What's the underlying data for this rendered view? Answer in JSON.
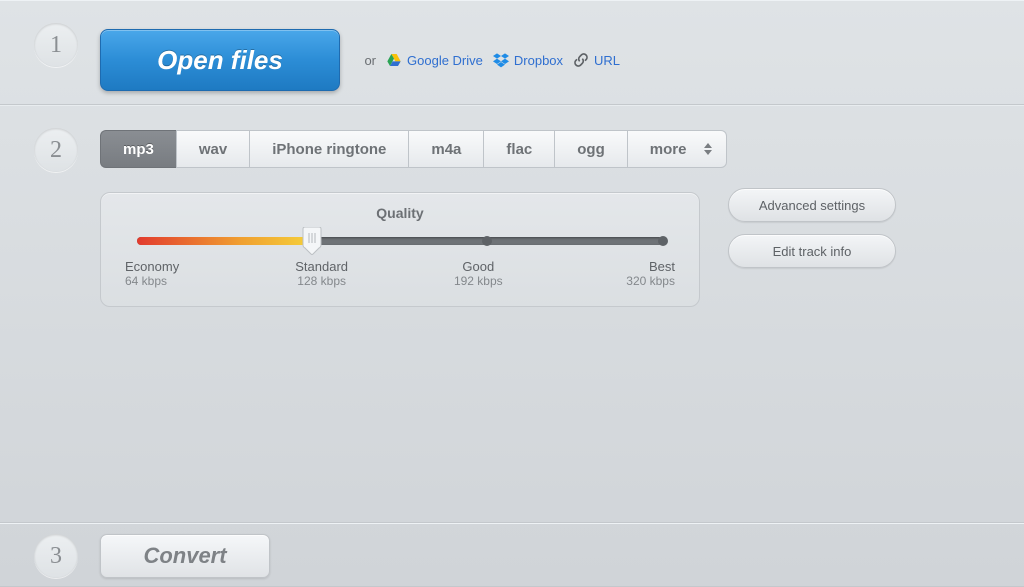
{
  "step1": {
    "badge": "1",
    "open_files_label": "Open files",
    "or_label": "or",
    "google_drive_label": "Google Drive",
    "dropbox_label": "Dropbox",
    "url_label": "URL"
  },
  "step2": {
    "badge": "2",
    "formats": {
      "mp3": "mp3",
      "wav": "wav",
      "iphone": "iPhone ringtone",
      "m4a": "m4a",
      "flac": "flac",
      "ogg": "ogg",
      "more": "more"
    },
    "quality": {
      "title": "Quality",
      "stops": [
        {
          "name": "Economy",
          "rate": "64 kbps"
        },
        {
          "name": "Standard",
          "rate": "128 kbps"
        },
        {
          "name": "Good",
          "rate": "192 kbps"
        },
        {
          "name": "Best",
          "rate": "320 kbps"
        }
      ],
      "selected_index": 1
    },
    "advanced_label": "Advanced settings",
    "edit_track_label": "Edit track info"
  },
  "step3": {
    "badge": "3",
    "convert_label": "Convert"
  }
}
